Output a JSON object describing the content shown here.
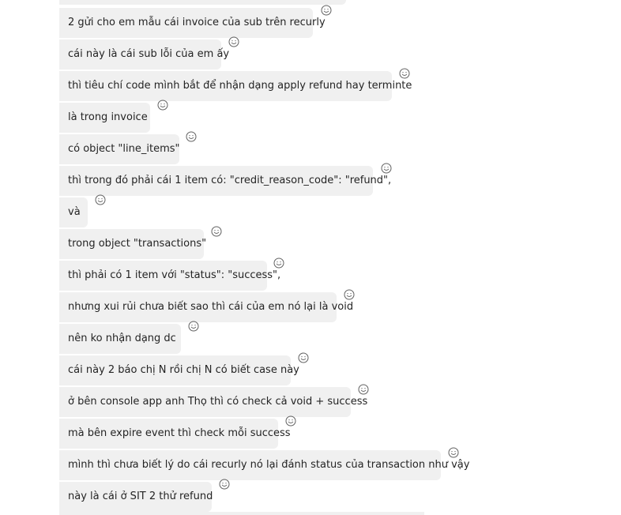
{
  "colors": {
    "bubble_bg": "#f0f0f0",
    "text": "#242424",
    "icon": "#616161"
  },
  "reaction_icon": "smiley-face-icon",
  "messages": [
    {
      "text": "2 gửi cho em mẫu  cái invoice của sub trên recurly"
    },
    {
      "text": "cái này là cái sub lỗi của em ấy"
    },
    {
      "text": "thì tiêu chí code mình bắt để nhận dạng apply refund hay terminte"
    },
    {
      "text": "là trong invoice"
    },
    {
      "text": "có object \"line_items\""
    },
    {
      "text": "thì trong đó phải cái 1 item có:  \"credit_reason_code\": \"refund\","
    },
    {
      "text": "và"
    },
    {
      "text": "trong object \"transactions\""
    },
    {
      "text": "thì phải có 1 item với \"status\": \"success\","
    },
    {
      "text": "nhưng xui rủi chưa biết sao thì cái của em nó lại là void"
    },
    {
      "text": " nên ko nhận dạng dc"
    },
    {
      "text": "cái này 2 báo chị N rồi chị N có biết case này"
    },
    {
      "text": "ở bên console app anh Thọ thì có check cả void + success"
    },
    {
      "text": "mà bên expire event thì check mỗi success"
    },
    {
      "text": "mình thì chưa biết lý do cái recurly nó lại đánh status của transaction như vậy"
    },
    {
      "text": "này là cái ở SIT 2 thử refund"
    }
  ]
}
